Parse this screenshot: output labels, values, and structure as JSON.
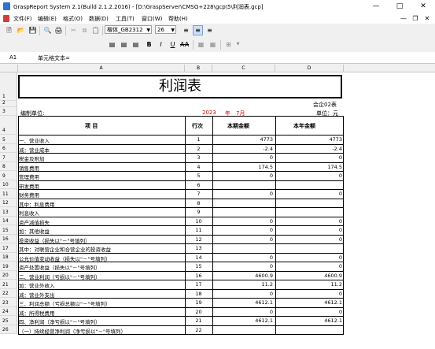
{
  "window": {
    "title": "GraspReport System 2.1(Build 2.1.2.2016) - [D:\\GraspServer\\CMSQ+228\\gcp\\5\\利润表.gcp]",
    "min_icon": "minimize-icon",
    "max_icon": "maximize-icon",
    "close_icon": "close-icon"
  },
  "menu": [
    "文件(F)",
    "编辑(E)",
    "格式(O)",
    "数据(D)",
    "工具(T)",
    "窗口(W)",
    "帮助(H)"
  ],
  "toolbar": {
    "font_name": "楷体_GB2312",
    "font_size": "26",
    "bold": "B",
    "italic": "I",
    "underline": "U",
    "strike": "AA"
  },
  "formula_bar": {
    "cell_ref": "A1",
    "content": "单元格文本="
  },
  "columns": [
    "A",
    "B",
    "C",
    "D"
  ],
  "report": {
    "title": "利润表",
    "form_no": "会企02表",
    "unit_label": "编制单位:",
    "period_year": "2023",
    "year_char": "年",
    "period_month": "7月",
    "currency_unit": "单位：元",
    "headers": {
      "item": "项          目",
      "line": "行次",
      "current": "本期金额",
      "ytd": "本年金额"
    }
  },
  "rows": [
    {
      "num": "5",
      "item": "一、营业收入",
      "line": "1",
      "current": "4773",
      "ytd": "4773"
    },
    {
      "num": "6",
      "item": "    减：营业成本",
      "line": "2",
      "current": "-2.4",
      "ytd": "-2.4"
    },
    {
      "num": "7",
      "item": "          税金及附加",
      "line": "3",
      "current": "0",
      "ytd": "0"
    },
    {
      "num": "8",
      "item": "          销售费用",
      "line": "4",
      "current": "174.5",
      "ytd": "174.5"
    },
    {
      "num": "9",
      "item": "          管理费用",
      "line": "5",
      "current": "0",
      "ytd": "0"
    },
    {
      "num": "10",
      "item": "          研发费用",
      "line": "6",
      "current": "",
      "ytd": ""
    },
    {
      "num": "11",
      "item": "          财务费用",
      "line": "7",
      "current": "0",
      "ytd": "0"
    },
    {
      "num": "12",
      "item": "              其中：利息费用",
      "line": "8",
      "current": "",
      "ytd": ""
    },
    {
      "num": "13",
      "item": "                       利息收入",
      "line": "9",
      "current": "",
      "ytd": ""
    },
    {
      "num": "14",
      "item": "          资产减值损失",
      "line": "10",
      "current": "0",
      "ytd": "0"
    },
    {
      "num": "15",
      "item": "    加：其他收益",
      "line": "11",
      "current": "0",
      "ytd": "0"
    },
    {
      "num": "16",
      "item": "          投资收益（损失以\"－\"号填列）",
      "line": "12",
      "current": "0",
      "ytd": "0"
    },
    {
      "num": "17",
      "item": "              其中：对联营企业和合营企业的投资收益",
      "line": "13",
      "current": "",
      "ytd": ""
    },
    {
      "num": "18",
      "item": "          公允价值变动收益（损失以\"－\"号填列）",
      "line": "14",
      "current": "0",
      "ytd": "0"
    },
    {
      "num": "19",
      "item": "          资产处置收益（损失以\"－\"号填列）",
      "line": "15",
      "current": "0",
      "ytd": "0"
    },
    {
      "num": "20",
      "item": "二、营业利润（亏损以\"－\"号填列）",
      "line": "16",
      "current": "4600.9",
      "ytd": "4600.9"
    },
    {
      "num": "21",
      "item": "    加：营业外收入",
      "line": "17",
      "current": "11.2",
      "ytd": "11.2"
    },
    {
      "num": "22",
      "item": "    减：营业外支出",
      "line": "18",
      "current": "0",
      "ytd": "0"
    },
    {
      "num": "23",
      "item": "三、利润总额（亏损总额以\"－\"号填列）",
      "line": "19",
      "current": "4612.1",
      "ytd": "4612.1"
    },
    {
      "num": "24",
      "item": "    减：所得税费用",
      "line": "20",
      "current": "0",
      "ytd": "0"
    },
    {
      "num": "25",
      "item": "四、净利润（净亏损以\"－\"号填列）",
      "line": "21",
      "current": "4612.1",
      "ytd": "4612.1"
    },
    {
      "num": "26",
      "item": "    （一）持续经营净利润（净亏损以\"－\"号填列）",
      "line": "22",
      "current": "",
      "ytd": ""
    }
  ]
}
